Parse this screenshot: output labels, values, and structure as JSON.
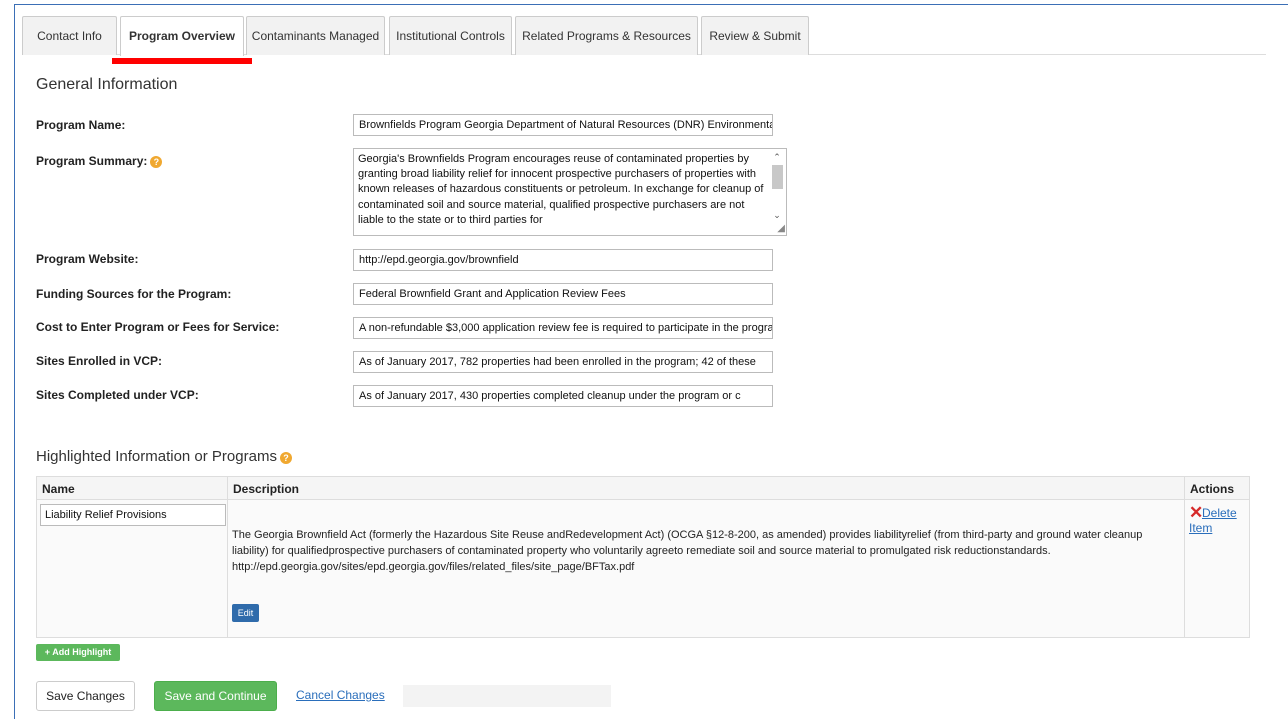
{
  "tabs": [
    {
      "label": "Contact Info",
      "active": false
    },
    {
      "label": "Program Overview",
      "active": true
    },
    {
      "label": "Contaminants Managed",
      "active": false
    },
    {
      "label": "Institutional Controls",
      "active": false
    },
    {
      "label": "Related Programs & Resources",
      "active": false
    },
    {
      "label": "Review & Submit",
      "active": false
    }
  ],
  "general": {
    "title": "General Information",
    "program_name_label": "Program Name:",
    "program_name_value": "Brownfields Program Georgia Department of Natural Resources (DNR) Environmental Protection Division",
    "program_summary_label": "Program Summary:",
    "program_summary_value": "Georgia's Brownfields Program encourages reuse of contaminated properties by granting broad liability relief for innocent prospective purchasers of properties with known releases of hazardous constituents or petroleum. In exchange for cleanup of contaminated soil and source material, qualified prospective purchasers are not liable to the state or to third parties for",
    "program_website_label": "Program Website:",
    "program_website_value": "http://epd.georgia.gov/brownfield",
    "funding_label": "Funding Sources for the Program:",
    "funding_value": "Federal Brownfield Grant and Application Review Fees",
    "cost_label": "Cost to Enter Program or Fees for Service:",
    "cost_value": "A non-refundable $3,000 application review fee is required to participate in the program",
    "enrolled_label": "Sites Enrolled in VCP:",
    "enrolled_value": "As of January 2017, 782 properties had been enrolled in the program; 42 of these",
    "completed_label": "Sites Completed under VCP:",
    "completed_value": "As of January 2017, 430 properties completed cleanup under the program or c"
  },
  "highlights": {
    "title": "Highlighted Information or Programs",
    "col_name": "Name",
    "col_description": "Description",
    "col_actions": "Actions",
    "row_name": "Liability Relief Provisions",
    "row_description": "The Georgia Brownfield Act (formerly the Hazardous Site Reuse andRedevelopment Act) (OCGA §12-8-200, as amended) provides liabilityrelief (from third-party and ground water cleanup liability) for qualifiedprospective purchasers of contaminated property who voluntarily agreeto remediate soil and source material to promulgated risk reductionstandards. http://epd.georgia.gov/sites/epd.georgia.gov/files/related_files/site_page/BFTax.pdf",
    "edit_label": "Edit",
    "delete_label": "Delete Item",
    "add_label": "+ Add Highlight"
  },
  "footer": {
    "save_label": "Save Changes",
    "continue_label": "Save and Continue",
    "cancel_label": "Cancel Changes"
  },
  "icons": {
    "info": "info-icon",
    "delete": "close-icon"
  },
  "colors": {
    "accent_red": "#ff0000",
    "green": "#5cb85c",
    "blue": "#2f6bab",
    "link": "#2a6ebb",
    "info": "#f0a830"
  }
}
